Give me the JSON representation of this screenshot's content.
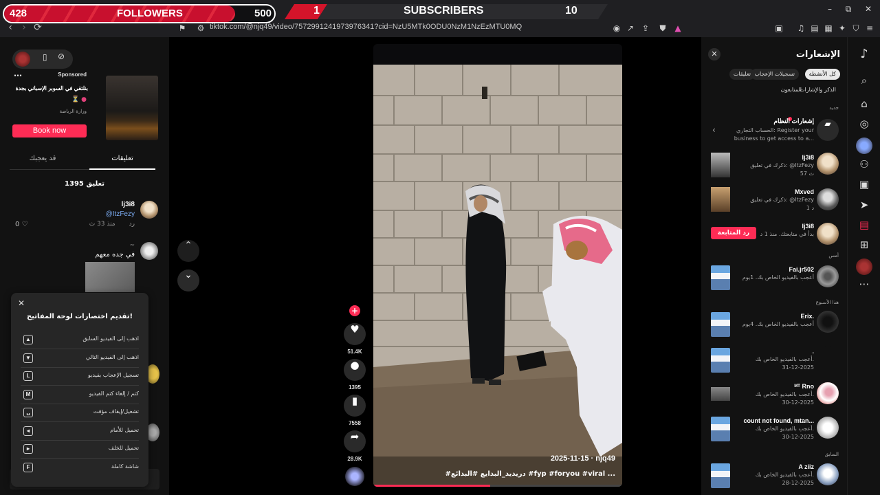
{
  "overlay": {
    "followers_count": "428",
    "followers_label": "FOLLOWERS",
    "followers_goal": "500",
    "followers_progress": 0.856,
    "subscribers_count": "1",
    "subscribers_label": "SUBSCRIBERS",
    "subscribers_goal": "10"
  },
  "browser": {
    "url": "tiktok.com/@njq49/video/7572991241973976341?cid=NzU5MTk0ODU0NzM1NzEzMTU0MQ",
    "minimize_icon": "minimize-icon",
    "restore_icon": "restore-icon",
    "close_icon": "close-icon"
  },
  "ad": {
    "sponsored": "Sponsored",
    "title": "بنلتقي في السوبر الإسباني بجدة",
    "org": "وزارة الرياضة",
    "cta": "Book now"
  },
  "left_tabs": {
    "comments": "تعليقات",
    "you_may_like": "قد يعجبك"
  },
  "comments": {
    "count_label": "1395 تعليق",
    "items": [
      {
        "name": "lj3i8",
        "text": "@ItzFezy",
        "time": "منذ 33 ث",
        "reply": "رد",
        "likes": "0"
      },
      {
        "name": "~",
        "text": "في جده معهم"
      }
    ]
  },
  "keyboard": {
    "title": "تقديم اختصارات لوحة المفاتيح!",
    "rows": [
      {
        "key": "▲",
        "label": "اذهب إلى الفيديو السابق"
      },
      {
        "key": "▼",
        "label": "اذهب إلى الفيديو التالي"
      },
      {
        "key": "L",
        "label": "تسجيل الإعجاب بفيديو"
      },
      {
        "key": "M",
        "label": "كتم / إلغاء كتم الفيديو"
      },
      {
        "key": "␣",
        "label": "تشغيل/إيقاف مؤقت"
      },
      {
        "key": "◂",
        "label": "تحميل للأمام"
      },
      {
        "key": "▸",
        "label": "تحميل للخلف"
      },
      {
        "key": "F",
        "label": "شاشة كاملة"
      }
    ]
  },
  "video": {
    "author": "njq49",
    "date": "2025-11-15",
    "caption": "#دريديد_البدايع #البدائع #fyp #foryou #viral ...",
    "progress": 0.47,
    "likes": "51.4K",
    "comments": "1395",
    "saves": "7558",
    "shares": "28.9K"
  },
  "notifications": {
    "title": "الإشعارات",
    "chips": [
      "كل الأنشطة",
      "تسجيلات الإعجاب",
      "تعليقات",
      "الذكر والإشارات",
      "المتابعون"
    ],
    "section_new": "جديد",
    "section_yesterday": "أمس",
    "section_week": "هذا الأسبوع",
    "section_previous": "السابق",
    "system": {
      "title": "إشعارات النظام",
      "text_1": "الحساب التجاري: Register your",
      "text_2": "business to get access to a..."
    },
    "items": [
      {
        "name": "lj3i8",
        "line1": "ذكرك في تعليق: @ItzFezy",
        "line2": "منذ",
        "line3": "57 ث"
      },
      {
        "name": "Mxved",
        "line1": "ذكرك في تعليق: @ItzFezy",
        "line2": "منذ",
        "line3": "1 د"
      },
      {
        "name": "lj3i8",
        "line1": "بدأ في متابعتك. منذ 1 د",
        "button": "رد المتابعة"
      },
      {
        "name": "Fai.jr502",
        "line1": "أعجب بالفيديو الخاص بك. 1يوم"
      },
      {
        "name": "Erix.",
        "line1": "أعجب بالفيديو الخاص بك. 4يوم"
      },
      {
        "name": ".",
        "line1": "أعجب بالفيديو الخاص بك.",
        "line2": "31-12-2025"
      },
      {
        "name": "ᴹᵀ Rno",
        "line1": "أعجب بالفيديو الخاص بك.",
        "line2": "30-12-2025"
      },
      {
        "name": "count not found, mtan...",
        "line1": "أعجب بالفيديو الخاص بك.",
        "line2": "30-12-2025"
      },
      {
        "name": "A ziiz",
        "line1": "أعجب بالفيديو الخاص بك.",
        "line2": "28-12-2025"
      }
    ]
  },
  "colors": {
    "accent": "#fe2c55",
    "overlay_red": "#c8102e",
    "panel_bg": "#121212"
  }
}
